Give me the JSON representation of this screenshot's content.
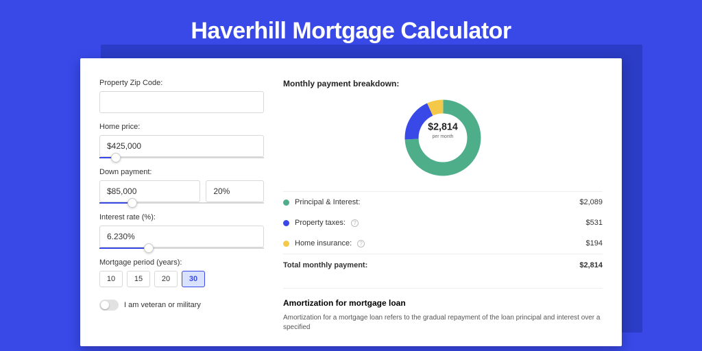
{
  "title": "Haverhill Mortgage Calculator",
  "form": {
    "zip_label": "Property Zip Code:",
    "zip_value": "",
    "home_price_label": "Home price:",
    "home_price_value": "$425,000",
    "home_price_slider_pct": 10,
    "down_payment_label": "Down payment:",
    "down_payment_value": "$85,000",
    "down_payment_pct_value": "20%",
    "down_payment_slider_pct": 20,
    "interest_label": "Interest rate (%):",
    "interest_value": "6.230%",
    "interest_slider_pct": 30,
    "period_label": "Mortgage period (years):",
    "periods": [
      "10",
      "15",
      "20",
      "30"
    ],
    "period_active_index": 3,
    "veteran_label": "I am veteran or military"
  },
  "breakdown": {
    "title": "Monthly payment breakdown:",
    "center_amount": "$2,814",
    "center_sub": "per month",
    "items": [
      {
        "label": "Principal & Interest:",
        "value": "$2,089",
        "color": "g",
        "info": false
      },
      {
        "label": "Property taxes:",
        "value": "$531",
        "color": "b",
        "info": true
      },
      {
        "label": "Home insurance:",
        "value": "$194",
        "color": "y",
        "info": true
      }
    ],
    "total_label": "Total monthly payment:",
    "total_value": "$2,814"
  },
  "chart_data": {
    "type": "pie",
    "title": "Monthly payment breakdown",
    "series": [
      {
        "name": "Principal & Interest",
        "value": 2089,
        "color": "#4fae8a"
      },
      {
        "name": "Property taxes",
        "value": 531,
        "color": "#3849e8"
      },
      {
        "name": "Home insurance",
        "value": 194,
        "color": "#f4c94a"
      }
    ],
    "total": 2814,
    "center_label": "$2,814 per month"
  },
  "amort": {
    "title": "Amortization for mortgage loan",
    "body": "Amortization for a mortgage loan refers to the gradual repayment of the loan principal and interest over a specified"
  }
}
